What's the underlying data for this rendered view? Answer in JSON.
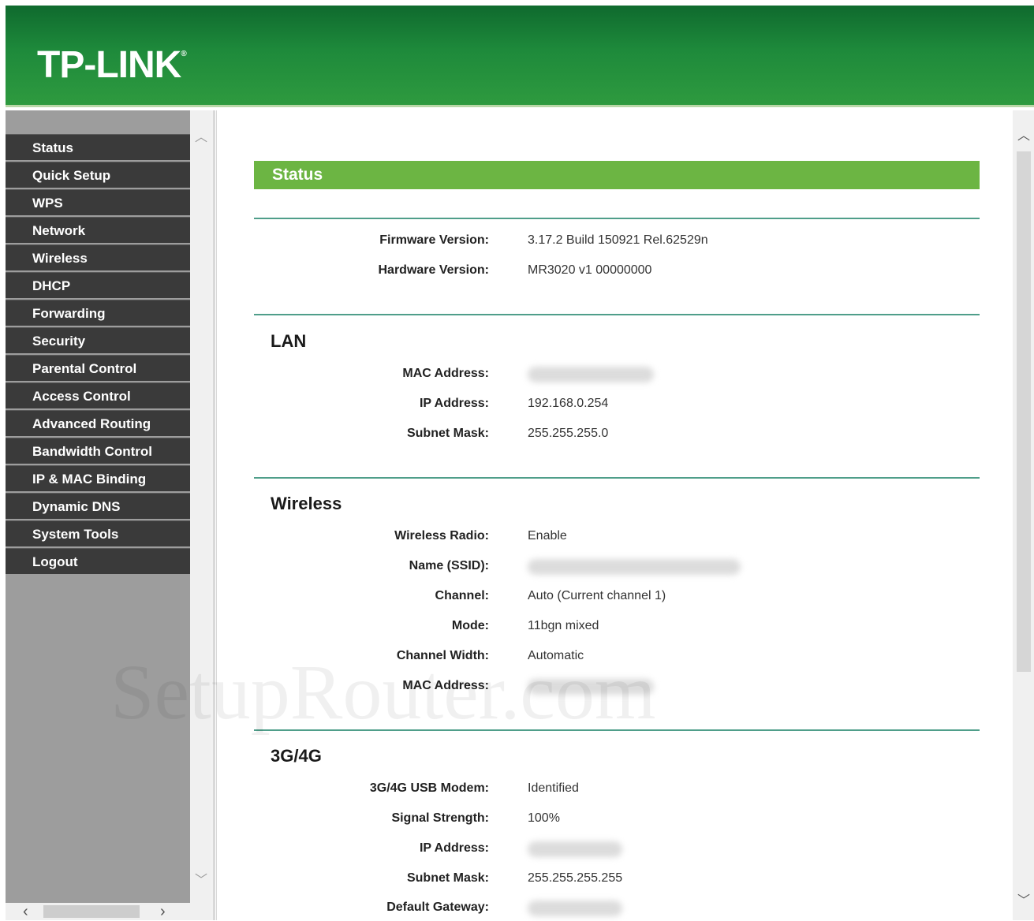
{
  "header": {
    "logo_text": "TP-LINK",
    "logo_mark": "®"
  },
  "menu": {
    "items": [
      {
        "label": "Status"
      },
      {
        "label": "Quick Setup"
      },
      {
        "label": "WPS"
      },
      {
        "label": "Network"
      },
      {
        "label": "Wireless"
      },
      {
        "label": "DHCP"
      },
      {
        "label": "Forwarding"
      },
      {
        "label": "Security"
      },
      {
        "label": "Parental Control"
      },
      {
        "label": "Access Control"
      },
      {
        "label": "Advanced Routing"
      },
      {
        "label": "Bandwidth Control"
      },
      {
        "label": "IP & MAC Binding"
      },
      {
        "label": "Dynamic DNS"
      },
      {
        "label": "System Tools"
      },
      {
        "label": "Logout"
      }
    ]
  },
  "content": {
    "title": "Status",
    "info": {
      "firmware_label": "Firmware Version:",
      "firmware_value": "3.17.2 Build 150921 Rel.62529n",
      "hardware_label": "Hardware Version:",
      "hardware_value": "MR3020 v1 00000000"
    },
    "lan": {
      "title": "LAN",
      "mac_label": "MAC Address:",
      "ip_label": "IP Address:",
      "ip_value": "192.168.0.254",
      "mask_label": "Subnet Mask:",
      "mask_value": "255.255.255.0"
    },
    "wireless": {
      "title": "Wireless",
      "radio_label": "Wireless Radio:",
      "radio_value": "Enable",
      "ssid_label": "Name (SSID):",
      "channel_label": "Channel:",
      "channel_value": "Auto (Current channel 1)",
      "mode_label": "Mode:",
      "mode_value": "11bgn mixed",
      "width_label": "Channel Width:",
      "width_value": "Automatic",
      "mac_label": "MAC Address:"
    },
    "g34": {
      "title": "3G/4G",
      "modem_label": "3G/4G USB Modem:",
      "modem_value": "Identified",
      "signal_label": "Signal Strength:",
      "signal_value": "100%",
      "ip_label": "IP Address:",
      "mask_label": "Subnet Mask:",
      "mask_value": "255.255.255.255",
      "gateway_label": "Default Gateway:"
    }
  },
  "watermark": "SetupRouter.com"
}
